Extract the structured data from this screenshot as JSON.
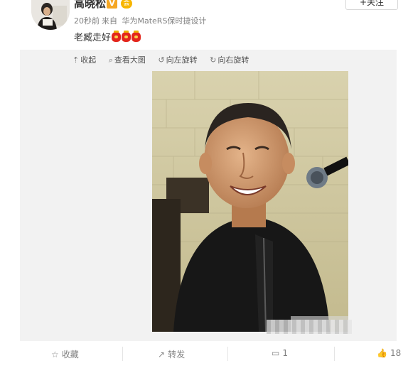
{
  "user": {
    "name": "高晓松",
    "verified_badge": "V",
    "member_badge": "会"
  },
  "follow_label": "+关注",
  "meta": {
    "time": "20秒前",
    "from_label": "来自",
    "device": "华为MateRS保时捷设计"
  },
  "post": {
    "text": "老臧走好",
    "emoji_icons": [
      "lantern-icon",
      "lantern-icon",
      "lantern-icon"
    ]
  },
  "media_toolbar": [
    {
      "icon": "collapse-icon",
      "label": "收起"
    },
    {
      "icon": "magnifier-icon",
      "label": "查看大图"
    },
    {
      "icon": "rotate-left-icon",
      "label": "向左旋转"
    },
    {
      "icon": "rotate-right-icon",
      "label": "向右旋转"
    }
  ],
  "actions": {
    "favorite": {
      "icon": "star-icon",
      "label": "收藏"
    },
    "repost": {
      "icon": "share-icon",
      "label": "转发"
    },
    "comment": {
      "icon": "comment-icon",
      "count": "1"
    },
    "like": {
      "icon": "thumbs-up-icon",
      "count": "18"
    }
  },
  "colors": {
    "accent": "#ff8200",
    "meta_text": "#808080",
    "media_bg": "#f2f2f2",
    "badge": "#f5a623"
  }
}
